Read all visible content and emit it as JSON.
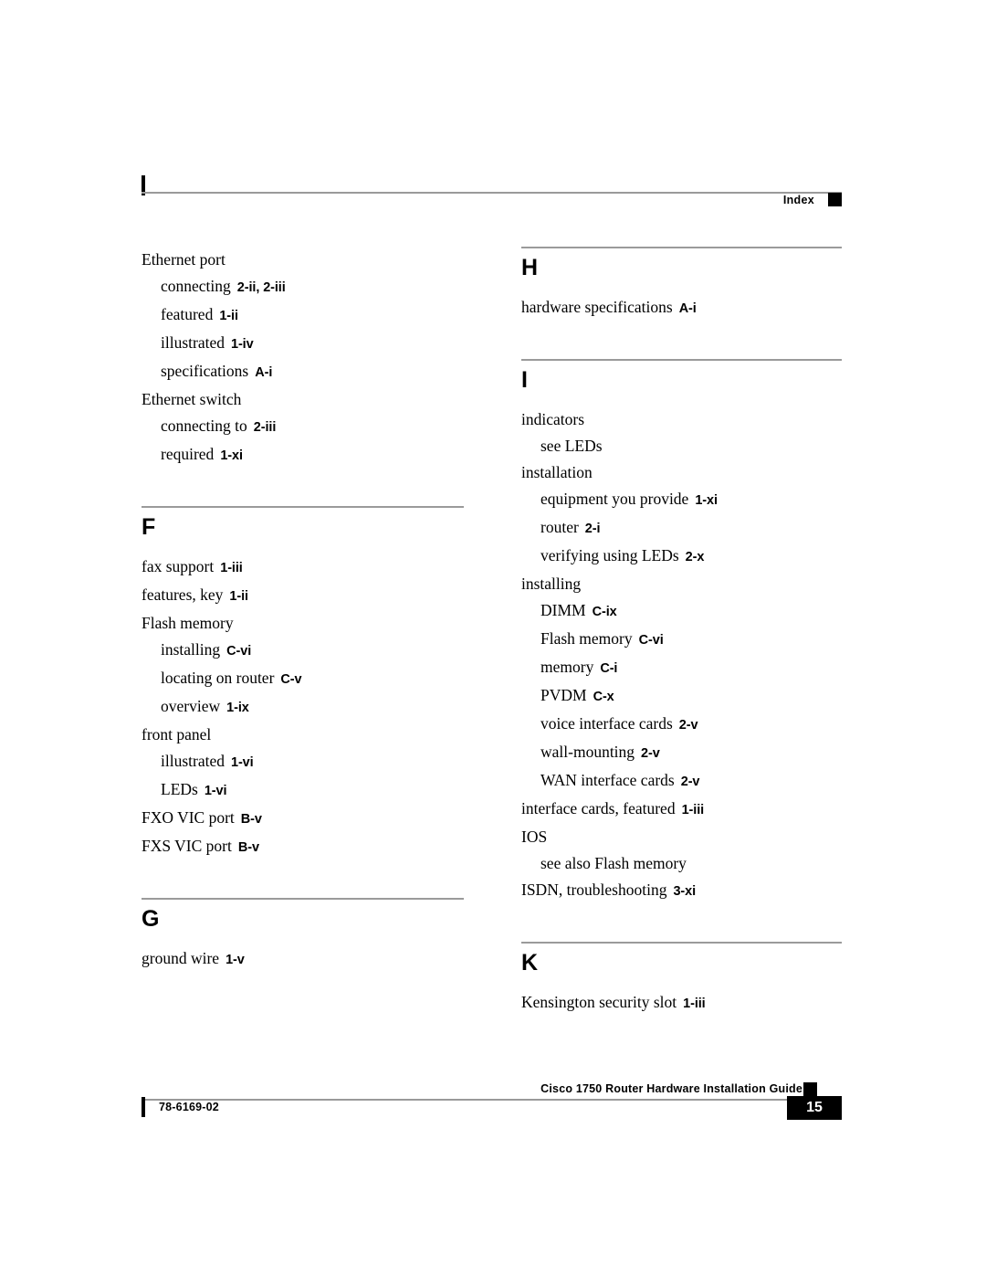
{
  "header": {
    "label": "Index",
    "marker_icon": "black-square-icon"
  },
  "footer": {
    "title": "Cisco 1750 Router Hardware Installation Guide",
    "doc_number": "78-6169-02",
    "page_number": "15",
    "marker_icon": "black-square-icon"
  },
  "columns": {
    "left": {
      "sections": [
        {
          "letter": "",
          "has_rule": false,
          "entries": [
            {
              "level": 1,
              "text": "Ethernet port",
              "locator": ""
            },
            {
              "level": 2,
              "text": "connecting",
              "locator": "2-ii, 2-iii"
            },
            {
              "level": 2,
              "text": "featured",
              "locator": "1-ii"
            },
            {
              "level": 2,
              "text": "illustrated",
              "locator": "1-iv"
            },
            {
              "level": 2,
              "text": "specifications",
              "locator": "A-i"
            },
            {
              "level": 1,
              "text": "Ethernet switch",
              "locator": ""
            },
            {
              "level": 2,
              "text": "connecting to",
              "locator": "2-iii"
            },
            {
              "level": 2,
              "text": "required",
              "locator": "1-xi"
            }
          ]
        },
        {
          "letter": "F",
          "has_rule": true,
          "entries": [
            {
              "level": 1,
              "text": "fax support",
              "locator": "1-iii"
            },
            {
              "level": 1,
              "text": "features, key",
              "locator": "1-ii"
            },
            {
              "level": 1,
              "text": "Flash memory",
              "locator": ""
            },
            {
              "level": 2,
              "text": "installing",
              "locator": "C-vi"
            },
            {
              "level": 2,
              "text": "locating on router",
              "locator": "C-v"
            },
            {
              "level": 2,
              "text": "overview",
              "locator": "1-ix"
            },
            {
              "level": 1,
              "text": "front panel",
              "locator": ""
            },
            {
              "level": 2,
              "text": "illustrated",
              "locator": "1-vi"
            },
            {
              "level": 2,
              "text": "LEDs",
              "locator": "1-vi"
            },
            {
              "level": 1,
              "text": "FXO VIC port",
              "locator": "B-v"
            },
            {
              "level": 1,
              "text": "FXS VIC port",
              "locator": "B-v"
            }
          ]
        },
        {
          "letter": "G",
          "has_rule": true,
          "entries": [
            {
              "level": 1,
              "text": "ground wire",
              "locator": "1-v"
            }
          ]
        }
      ]
    },
    "right": {
      "sections": [
        {
          "letter": "H",
          "has_rule": true,
          "entries": [
            {
              "level": 1,
              "text": "hardware specifications",
              "locator": "A-i"
            }
          ]
        },
        {
          "letter": "I",
          "has_rule": true,
          "entries": [
            {
              "level": 1,
              "text": "indicators",
              "locator": ""
            },
            {
              "level": 2,
              "text": "see LEDs",
              "locator": ""
            },
            {
              "level": 1,
              "text": "installation",
              "locator": ""
            },
            {
              "level": 2,
              "text": "equipment you provide",
              "locator": "1-xi"
            },
            {
              "level": 2,
              "text": "router",
              "locator": "2-i"
            },
            {
              "level": 2,
              "text": "verifying using LEDs",
              "locator": "2-x"
            },
            {
              "level": 1,
              "text": "installing",
              "locator": ""
            },
            {
              "level": 2,
              "text": "DIMM",
              "locator": "C-ix"
            },
            {
              "level": 2,
              "text": "Flash memory",
              "locator": "C-vi"
            },
            {
              "level": 2,
              "text": "memory",
              "locator": "C-i"
            },
            {
              "level": 2,
              "text": "PVDM",
              "locator": "C-x"
            },
            {
              "level": 2,
              "text": "voice interface cards",
              "locator": "2-v"
            },
            {
              "level": 2,
              "text": "wall-mounting",
              "locator": "2-v"
            },
            {
              "level": 2,
              "text": "WAN interface cards",
              "locator": "2-v"
            },
            {
              "level": 1,
              "text": "interface cards, featured",
              "locator": "1-iii"
            },
            {
              "level": 1,
              "text": "IOS",
              "locator": ""
            },
            {
              "level": 2,
              "text": "see also Flash memory",
              "locator": ""
            },
            {
              "level": 1,
              "text": "ISDN, troubleshooting",
              "locator": "3-xi"
            }
          ]
        },
        {
          "letter": "K",
          "has_rule": true,
          "entries": [
            {
              "level": 1,
              "text": "Kensington security slot",
              "locator": "1-iii"
            }
          ]
        }
      ]
    }
  }
}
